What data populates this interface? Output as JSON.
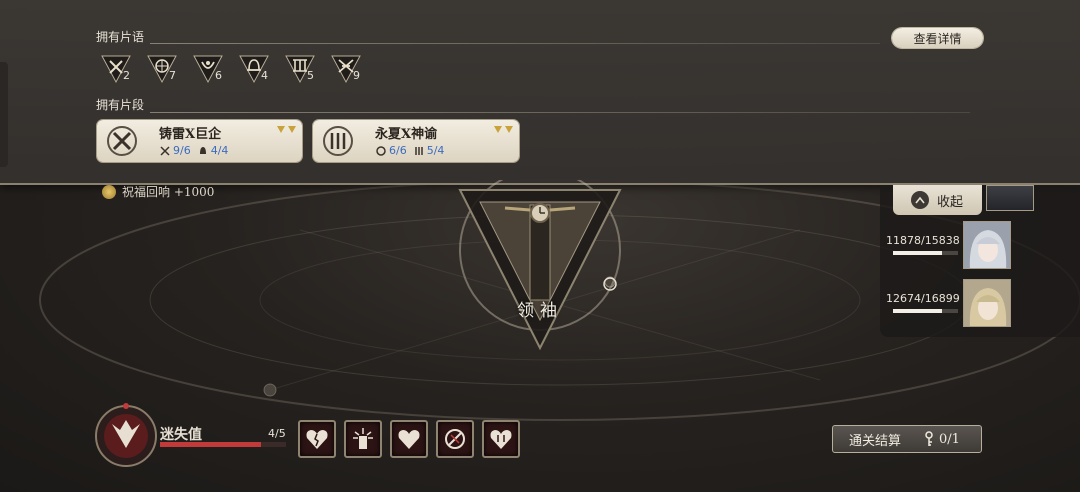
{
  "top_panel": {
    "fragments_title": "拥有片语",
    "segments_title": "拥有片段",
    "detail_button": "查看详情",
    "fragments": [
      {
        "icon": "swords-fragment-icon",
        "count": "2"
      },
      {
        "icon": "compass-fragment-icon",
        "count": "7"
      },
      {
        "icon": "wreath-fragment-icon",
        "count": "6"
      },
      {
        "icon": "bell-fragment-icon",
        "count": "4"
      },
      {
        "icon": "pillars-fragment-icon",
        "count": "5"
      },
      {
        "icon": "crossed-blades-fragment-icon",
        "count": "9"
      }
    ],
    "segments": [
      {
        "name": "铸雷X巨企",
        "stat1": "9/6",
        "stat2": "4/4"
      },
      {
        "name": "永夏X神谕",
        "stat1": "6/6",
        "stat2": "5/4"
      }
    ]
  },
  "bless": {
    "text": "祝福回响 +1000"
  },
  "leader": {
    "label": "领袖"
  },
  "team": {
    "collapse_label": "收起",
    "members": [
      {
        "hp": "11878/15838",
        "hp_ratio": 0.75
      },
      {
        "hp": "12674/16899",
        "hp_ratio": 0.75
      }
    ]
  },
  "lost": {
    "label": "迷失值",
    "count": "4/5",
    "ratio": 0.8
  },
  "settle": {
    "label": "通关结算",
    "keys": "0/1"
  },
  "colors": {
    "accent_red": "#c23a3a",
    "gold": "#c9a23c",
    "panel": "#3a3632",
    "highlight_blue": "#3b6bbf"
  }
}
